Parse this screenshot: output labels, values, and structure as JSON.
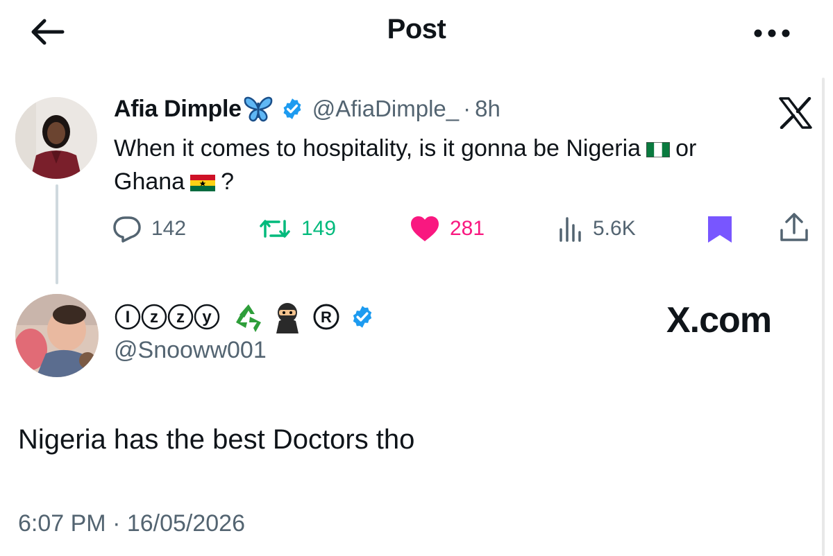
{
  "header": {
    "title": "Post",
    "back_icon": "arrow-left-icon",
    "more_icon": "more-horizontal-icon"
  },
  "quoted_tweet": {
    "display_name": "Afia Dimple",
    "name_emoji": "butterfly",
    "verified": true,
    "handle": "@AfiaDimple_",
    "separator": "·",
    "age": "8h",
    "text_part1": "When it comes to hospitality, is it gonna be Nigeria",
    "text_part2": "or",
    "text_part3": "Ghana",
    "text_part4": "?",
    "flags": [
      "nigeria-flag",
      "ghana-flag"
    ],
    "stats": {
      "replies": "142",
      "reposts": "149",
      "likes": "281",
      "views": "5.6K"
    }
  },
  "reply_tweet": {
    "display_name": "ⒾⓏⓏⓎ",
    "name_emojis": [
      "recycle-icon",
      "ninja-icon",
      "registered-icon"
    ],
    "verified": true,
    "handle": "@Snooww001",
    "watermark": "X.com",
    "text": "Nigeria has the best Doctors tho",
    "timestamp": "6:07 PM · 16/05/2026"
  },
  "colors": {
    "text": "#0f1419",
    "secondary": "#536471",
    "verified_blue": "#1d9bf0",
    "repost_green": "#00ba7c",
    "like_pink": "#f91880",
    "bookmark_purple": "#7856ff"
  }
}
